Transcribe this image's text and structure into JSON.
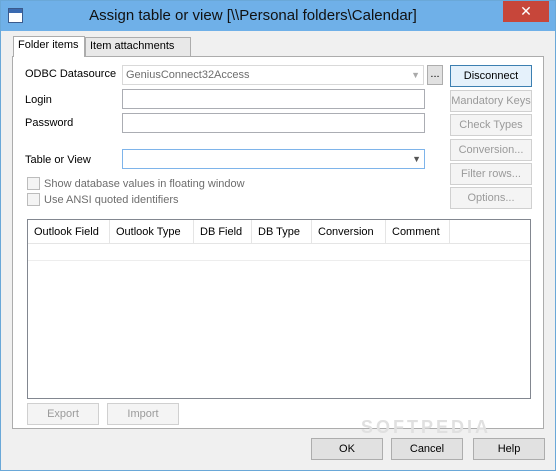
{
  "window": {
    "title": "Assign table or view [\\\\Personal folders\\Calendar]",
    "close_glyph": "✕"
  },
  "tabs": [
    {
      "label": "Folder items",
      "active": true
    },
    {
      "label": "Item attachments",
      "active": false
    }
  ],
  "form": {
    "odbc_label": "ODBC Datasource",
    "odbc_value": "GeniusConnect32Access",
    "browse_label": "...",
    "login_label": "Login",
    "login_value": "",
    "password_label": "Password",
    "password_value": "",
    "table_label": "Table or View",
    "table_value": "",
    "show_db_values_label": "Show database values in floating window",
    "ansi_quoted_label": "Use ANSI quoted identifiers"
  },
  "side_buttons": {
    "disconnect": "Disconnect",
    "mandatory_keys": "Mandatory Keys",
    "check_types": "Check Types",
    "conversion": "Conversion...",
    "filter_rows": "Filter rows...",
    "options": "Options..."
  },
  "grid": {
    "columns": [
      "Outlook Field",
      "Outlook Type",
      "DB Field",
      "DB Type",
      "Conversion",
      "Comment"
    ],
    "rows": []
  },
  "bottom_buttons": {
    "export": "Export",
    "import": "Import"
  },
  "footer_buttons": {
    "ok": "OK",
    "cancel": "Cancel",
    "help": "Help"
  },
  "watermark": "SOFTPEDIA",
  "colors": {
    "titlebar": "#6fb0e8",
    "close": "#c7463a",
    "default_button_border": "#3c7fb1"
  }
}
